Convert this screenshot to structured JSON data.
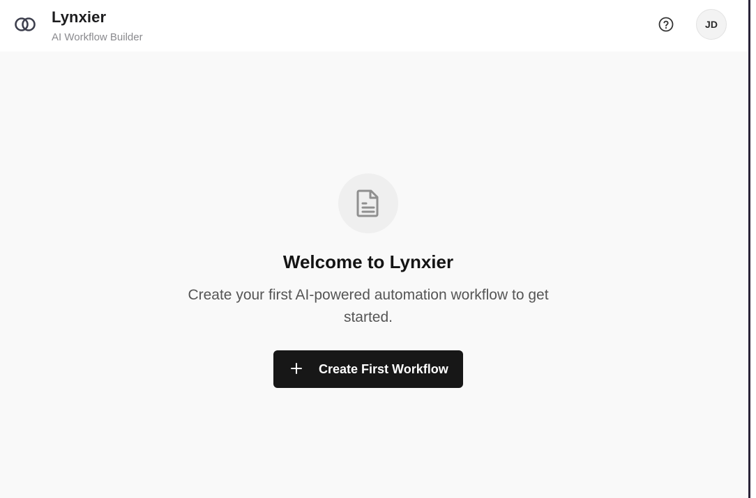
{
  "header": {
    "title": "Lynxier",
    "subtitle": "AI Workflow Builder",
    "logo_icon": "interlocking-rings-icon",
    "help_icon": "help-circle-icon",
    "avatar_initials": "JD"
  },
  "empty_state": {
    "icon": "document-icon",
    "title": "Welcome to Lynxier",
    "description": "Create your first AI-powered automation workflow to get started.",
    "cta_label": "Create First Workflow",
    "cta_icon": "plus-icon"
  },
  "colors": {
    "page_background": "#f9f9f9",
    "header_background": "#ffffff",
    "button_background": "#171717",
    "button_text": "#ffffff",
    "muted_text": "#8a8a8e"
  }
}
